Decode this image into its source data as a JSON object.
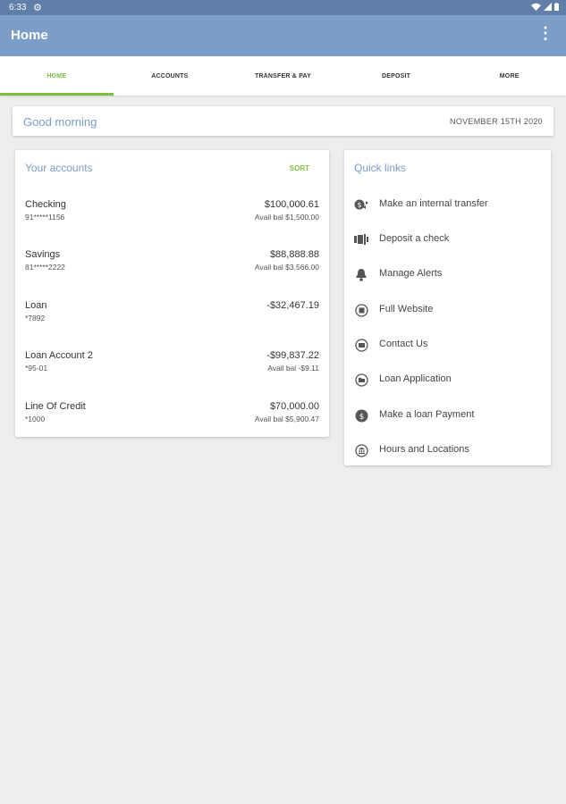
{
  "status_bar": {
    "time": "6:33"
  },
  "app_bar": {
    "title": "Home"
  },
  "tabs": [
    "HOME",
    "ACCOUNTS",
    "TRANSFER & PAY",
    "DEPOSIT",
    "MORE"
  ],
  "greeting": {
    "text": "Good morning",
    "date": "NOVEMBER 15TH 2020"
  },
  "accounts": {
    "title": "Your accounts",
    "sort_label": "SORT",
    "items": [
      {
        "name": "Checking",
        "number": "91*****1156",
        "balance": "$100,000.61",
        "avail": "Avail bal $1,500.00"
      },
      {
        "name": "Savings",
        "number": "81*****2222",
        "balance": "$88,888.88",
        "avail": "Avail bal $3,566.00"
      },
      {
        "name": "Loan",
        "number": "*7892",
        "balance": "-$32,467.19",
        "avail": ""
      },
      {
        "name": "Loan Account 2",
        "number": "*95-01",
        "balance": "-$99,837.22",
        "avail": "Avail bal -$9.11"
      },
      {
        "name": "Line Of Credit",
        "number": "*1000",
        "balance": "$70,000.00",
        "avail": "Avail bal $5,900.47"
      }
    ]
  },
  "quick_links": {
    "title": "Quick links",
    "items": [
      {
        "label": "Make an internal transfer",
        "icon": "transfer-icon"
      },
      {
        "label": "Deposit a check",
        "icon": "check-deposit-icon"
      },
      {
        "label": "Manage Alerts",
        "icon": "bell-icon"
      },
      {
        "label": "Full Website",
        "icon": "website-icon"
      },
      {
        "label": "Contact Us",
        "icon": "mail-icon"
      },
      {
        "label": "Loan Application",
        "icon": "folder-icon"
      },
      {
        "label": "Make a loan Payment",
        "icon": "dollar-icon"
      },
      {
        "label": "Hours and Locations",
        "icon": "bank-icon"
      }
    ]
  },
  "colors": {
    "app_bar": "#7b9ec8",
    "status_bar": "#5f7ea8",
    "accent_green": "#7bbf3e",
    "title_blue": "#7a9cc4"
  }
}
